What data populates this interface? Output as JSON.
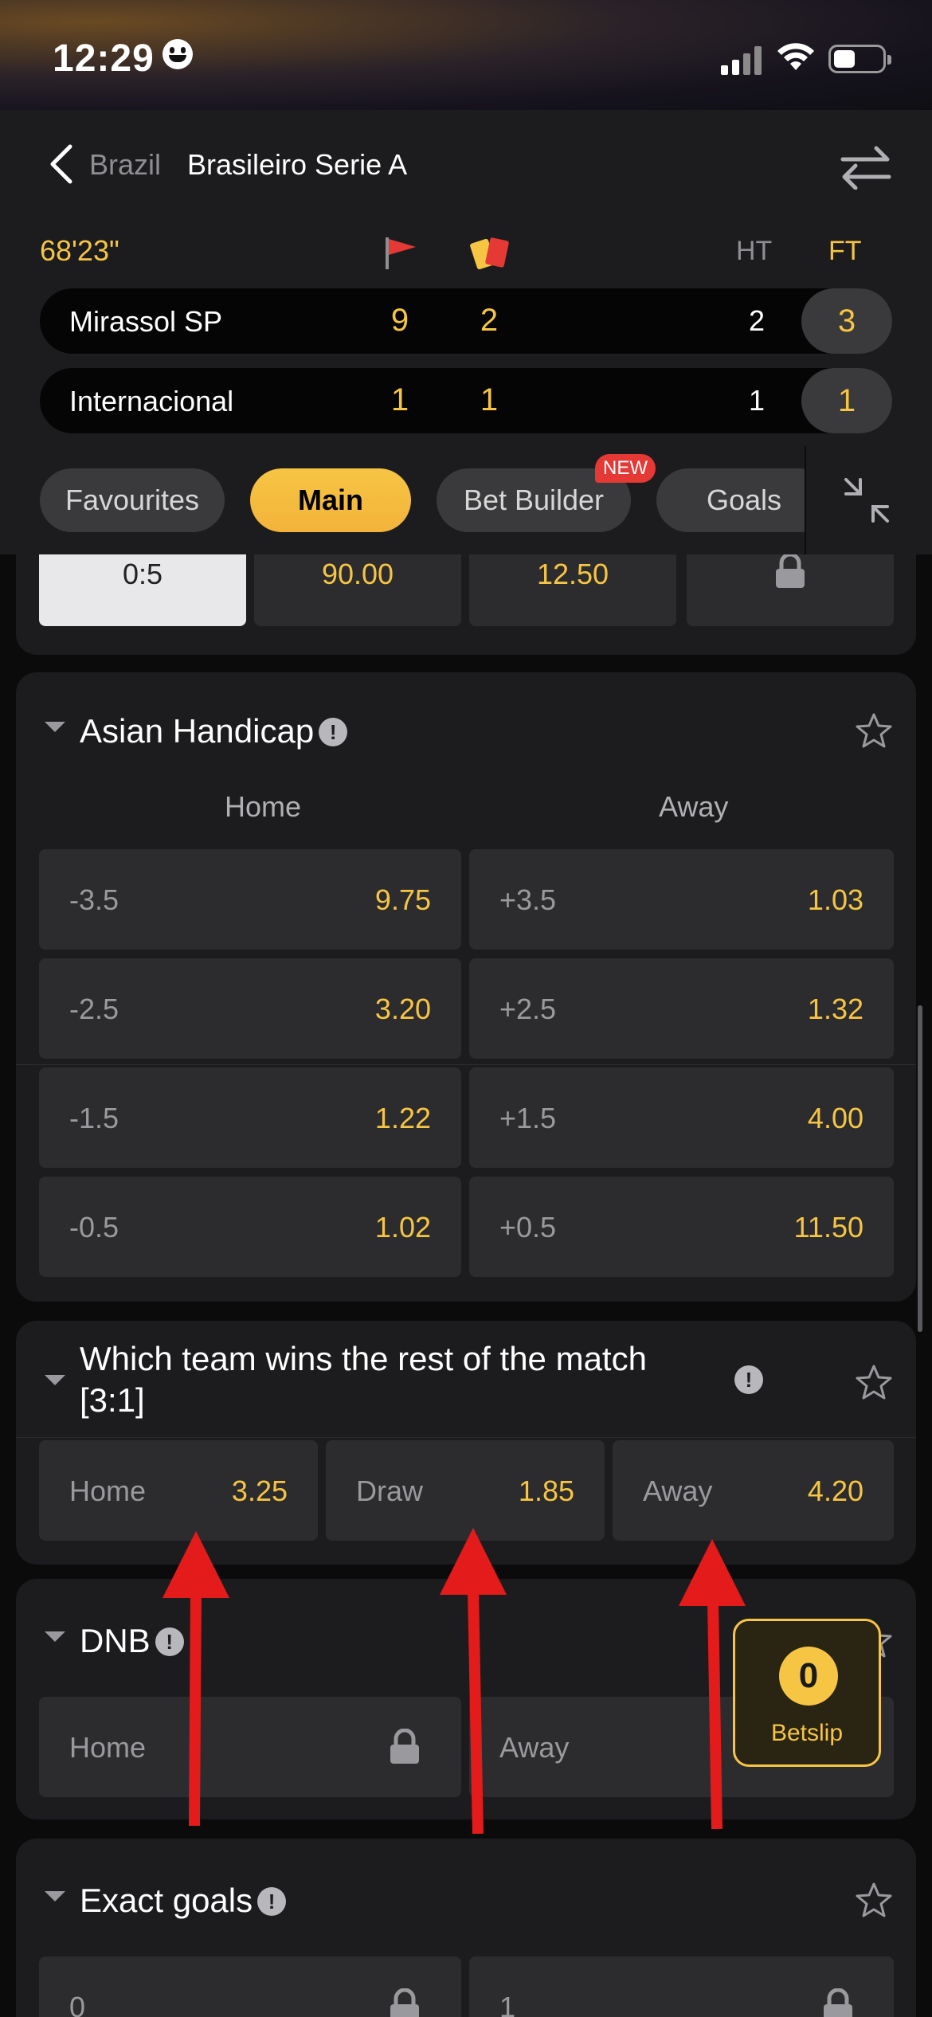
{
  "status_bar": {
    "time": "12:29"
  },
  "header": {
    "back_label": "Brazil",
    "league": "Brasileiro Serie A"
  },
  "scoreboard": {
    "clock": "68'23\"",
    "ht_label": "HT",
    "ft_label": "FT",
    "teams": [
      {
        "name": "Mirassol SP",
        "corners": "9",
        "cards": "2",
        "ht": "2",
        "ft": "3"
      },
      {
        "name": "Internacional",
        "corners": "1",
        "cards": "1",
        "ht": "1",
        "ft": "1"
      }
    ]
  },
  "tabs": [
    {
      "label": "Favourites"
    },
    {
      "label": "Main",
      "active": true
    },
    {
      "label": "Bet Builder",
      "badge": "NEW"
    },
    {
      "label": "Goals"
    }
  ],
  "top_row": {
    "selected": "0:5",
    "odds1": "90.00",
    "odds2": "12.50"
  },
  "asian_handicap": {
    "title": "Asian Handicap",
    "home_label": "Home",
    "away_label": "Away",
    "rows": [
      {
        "home_line": "-3.5",
        "home_odds": "9.75",
        "away_line": "+3.5",
        "away_odds": "1.03"
      },
      {
        "home_line": "-2.5",
        "home_odds": "3.20",
        "away_line": "+2.5",
        "away_odds": "1.32"
      },
      {
        "home_line": "-1.5",
        "home_odds": "1.22",
        "away_line": "+1.5",
        "away_odds": "4.00"
      },
      {
        "home_line": "-0.5",
        "home_odds": "1.02",
        "away_line": "+0.5",
        "away_odds": "11.50"
      }
    ]
  },
  "rest_of_match": {
    "title_line1": "Which team wins the rest of the match",
    "title_line2": "[3:1]",
    "options": [
      {
        "label": "Home",
        "odds": "3.25"
      },
      {
        "label": "Draw",
        "odds": "1.85"
      },
      {
        "label": "Away",
        "odds": "4.20"
      }
    ]
  },
  "dnb": {
    "title": "DNB",
    "home": "Home",
    "away": "Away"
  },
  "exact_goals": {
    "title": "Exact goals",
    "opt1": "0",
    "opt2": "1"
  },
  "betslip": {
    "count": "0",
    "label": "Betslip"
  },
  "colors": {
    "accent": "#f6c544",
    "background": "#0b0b0c",
    "card": "#1c1c1e",
    "cell": "#2c2c2e",
    "annotation": "#e31b1b"
  }
}
